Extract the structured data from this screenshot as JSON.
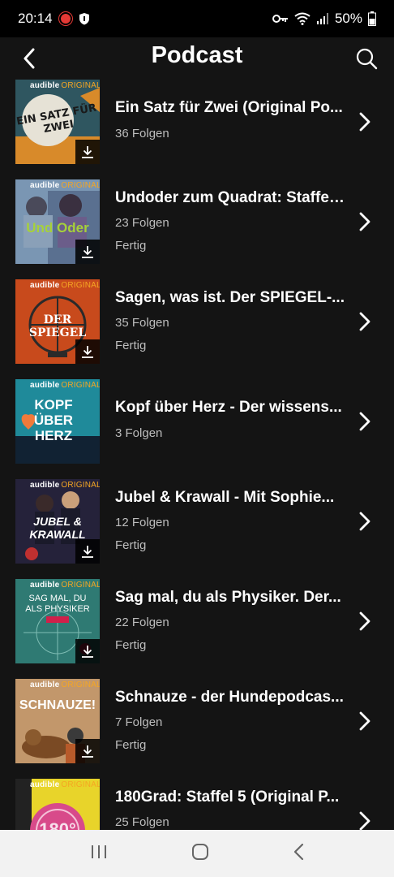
{
  "status": {
    "time": "20:14",
    "battery": "50%"
  },
  "header": {
    "title": "Podcast"
  },
  "podcasts": [
    {
      "title": "Ein Satz für Zwei (Original Po...",
      "episodes": "36 Folgen",
      "status": "",
      "badge": "audible",
      "badge2": "ORIGINAL",
      "art": "EIN SATZ FÜR ZWEI",
      "bg": "#2f5660"
    },
    {
      "title": "Undoder zum Quadrat: Staffel...",
      "episodes": "23 Folgen",
      "status": "Fertig",
      "badge": "audible",
      "badge2": "ORIGINAL",
      "art": "Und Oder",
      "bg": "#6e8bab"
    },
    {
      "title": "Sagen, was ist. Der SPIEGEL-...",
      "episodes": "35 Folgen",
      "status": "Fertig",
      "badge": "audible",
      "badge2": "ORIGINAL",
      "art": "DER SPIEGEL",
      "bg": "#c84a1c"
    },
    {
      "title": "Kopf über Herz - Der wissens...",
      "episodes": "3 Folgen",
      "status": "",
      "badge": "audible",
      "badge2": "ORIGINAL",
      "art": "KOPF ÜBER HERZ",
      "bg": "#1f8a9a"
    },
    {
      "title": "Jubel & Krawall - Mit Sophie...",
      "episodes": "12 Folgen",
      "status": "Fertig",
      "badge": "audible",
      "badge2": "ORIGINAL",
      "art": "JUBEL & KRAWALL",
      "bg": "#25223a"
    },
    {
      "title": "Sag mal, du als Physiker. Der...",
      "episodes": "22 Folgen",
      "status": "Fertig",
      "badge": "audible",
      "badge2": "ORIGINAL",
      "art": "SAG MAL, DU ALS PHYSIKER",
      "bg": "#2f7a73"
    },
    {
      "title": "Schnauze - der Hundepodcas...",
      "episodes": "7 Folgen",
      "status": "Fertig",
      "badge": "audible",
      "badge2": "ORIGINAL",
      "art": "SCHNAUZE!",
      "bg": "#c2976b"
    },
    {
      "title": "180Grad: Staffel 5 (Original P...",
      "episodes": "25 Folgen",
      "status": "",
      "badge": "audible",
      "badge2": "ORIGINAL",
      "art": "180°",
      "bg": "#e8d42a"
    }
  ]
}
